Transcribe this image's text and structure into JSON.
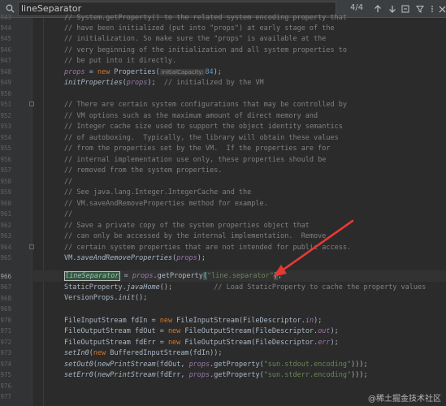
{
  "find_bar": {
    "query": "lineSeparator",
    "match_count": "4/4",
    "icons": [
      "search-icon",
      "previous-occurrence-icon",
      "next-occurrence-icon",
      "find-in-selection-icon",
      "options-filter-icon",
      "more-options-icon",
      "close-icon"
    ]
  },
  "editor": {
    "line_numbers": [
      "943",
      "944",
      "945",
      "946",
      "947",
      "948",
      "949",
      "950",
      "951",
      "952",
      "953",
      "954",
      "955",
      "956",
      "957",
      "958",
      "959",
      "960",
      "961",
      "962",
      "963",
      "964",
      "965",
      "966",
      "967",
      "968",
      "969",
      "970",
      "971",
      "972",
      "973",
      "974",
      "975",
      "976",
      "977"
    ],
    "current_line": "966",
    "code": {
      "l943": "// System.getProperty() to the related system encoding property that",
      "l944": "// have been initialized (put into \"props\") at early stage of the",
      "l945": "// initialization. So make sure the \"props\" is available at the",
      "l946": "// very beginning of the initialization and all system properties to",
      "l947": "// be put into it directly.",
      "l948_props": "props",
      "l948_eq": " = ",
      "l948_new": "new",
      "l948_ctor": " Properties(",
      "l948_hint": "initialCapacity:",
      "l948_num": "84",
      "l948_end": ");",
      "l949_call": "initProperties",
      "l949_open": "(",
      "l949_arg": "props",
      "l949_close": ");  ",
      "l949_cm": "// initialized by the VM",
      "l951": "// There are certain system configurations that may be controlled by",
      "l952": "// VM options such as the maximum amount of direct memory and",
      "l953": "// Integer cache size used to support the object identity semantics",
      "l954": "// of autoboxing.  Typically, the library will obtain these values",
      "l955": "// from the properties set by the VM.  If the properties are for",
      "l956": "// internal implementation use only, these properties should be",
      "l957": "// removed from the system properties.",
      "l958": "//",
      "l959": "// See java.lang.Integer.IntegerCache and the",
      "l960": "// VM.saveAndRemoveProperties method for example.",
      "l961": "//",
      "l962": "// Save a private copy of the system properties object that",
      "l963": "// can only be accessed by the internal implementation.  Remove",
      "l964": "// certain system properties that are not intended for public access.",
      "l965_a": "VM.",
      "l965_b": "saveAndRemoveProperties",
      "l965_c": "(",
      "l965_d": "props",
      "l965_e": ");",
      "l966_match": "lineSeparator",
      "l966_eq": " = ",
      "l966_props": "props",
      "l966_get": ".getProperty",
      "l966_open": "(",
      "l966_str": "\"line.separator\"",
      "l966_close": ")",
      "l966_semi": ";",
      "l967_a": "StaticProperty.",
      "l967_b": "javaHome",
      "l967_c": "();          ",
      "l967_cm": "// Load StaticProperty to cache the property values",
      "l968_a": "VersionProps.",
      "l968_b": "init",
      "l968_c": "();",
      "l970_a": "FileInputStream fdIn = ",
      "l970_new": "new",
      "l970_b": " FileInputStream(FileDescriptor.",
      "l970_f": "in",
      "l970_c": ");",
      "l971_a": "FileOutputStream fdOut = ",
      "l971_new": "new",
      "l971_b": " FileOutputStream(FileDescriptor.",
      "l971_f": "out",
      "l971_c": ");",
      "l972_a": "FileOutputStream fdErr = ",
      "l972_new": "new",
      "l972_b": " FileOutputStream(FileDescriptor.",
      "l972_f": "err",
      "l972_c": ");",
      "l973_m": "setIn0",
      "l973_a": "(",
      "l973_new": "new",
      "l973_b": " BufferedInputStream(fdIn));",
      "l974_m": "setOut0",
      "l974_a": "(",
      "l974_m2": "newPrintStream",
      "l974_b": "(fdOut, ",
      "l974_p": "props",
      "l974_c": ".getProperty(",
      "l974_s": "\"sun.stdout.encoding\"",
      "l974_d": ")));",
      "l975_m": "setErr0",
      "l975_a": "(",
      "l975_m2": "newPrintStream",
      "l975_b": "(fdErr, ",
      "l975_p": "props",
      "l975_c": ".getProperty(",
      "l975_s": "\"sun.stderr.encoding\"",
      "l975_d": ")));"
    }
  },
  "annotation": {
    "arrow_color": "#e53935"
  },
  "watermark": "@稀土掘金技术社区",
  "colors": {
    "background": "#2b2b2b",
    "comment": "#808080",
    "keyword": "#cc7832",
    "string": "#6a8759",
    "number": "#6897bb",
    "field": "#9876aa"
  }
}
